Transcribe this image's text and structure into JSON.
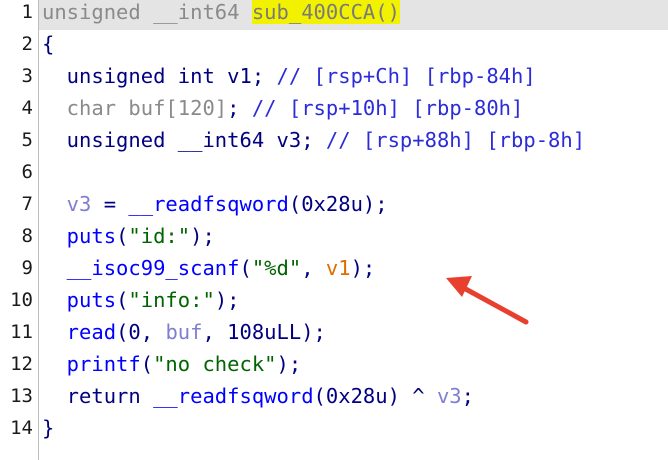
{
  "line_numbers": [
    "1",
    "2",
    "3",
    "4",
    "5",
    "6",
    "7",
    "8",
    "9",
    "10",
    "11",
    "12",
    "13",
    "14"
  ],
  "code": {
    "l1_type": "unsigned __int64 ",
    "l1_fname": "sub_400CCA",
    "l1_parens": "()",
    "l2": "{",
    "l3_type": "  unsigned int ",
    "l3_var": "v1",
    "l3_semi": "; ",
    "l3_comment": "// [rsp+Ch] [rbp-84h]",
    "l4_type": "  char ",
    "l4_var": "buf[120]",
    "l4_semi": "; ",
    "l4_comment": "// [rsp+10h] [rbp-80h]",
    "l5_type": "  unsigned __int64 ",
    "l5_var": "v3",
    "l5_semi": "; ",
    "l5_comment": "// [rsp+88h] [rbp-8h]",
    "l7_var": "  v3",
    "l7_eq": " = ",
    "l7_fn": "__readfsqword",
    "l7_args": "(0x28u);",
    "l8_fn": "  puts",
    "l8_open": "(",
    "l8_str": "\"id:\"",
    "l8_close": ");",
    "l9_fn": "  __isoc99_scanf",
    "l9_open": "(",
    "l9_str": "\"%d\"",
    "l9_comma": ", ",
    "l9_arg": "v1",
    "l9_close": ");",
    "l10_fn": "  puts",
    "l10_open": "(",
    "l10_str": "\"info:\"",
    "l10_close": ");",
    "l11_fn": "  read",
    "l11_a": "(0, ",
    "l11_buf": "buf",
    "l11_b": ", 108uLL);",
    "l12_fn": "  printf",
    "l12_open": "(",
    "l12_str": "\"no check\"",
    "l12_close": ");",
    "l13_kw": "  return ",
    "l13_fn": "__readfsqword",
    "l13_a": "(0x28u) ^ ",
    "l13_var": "v3",
    "l13_b": ";",
    "l14": "}"
  },
  "annotation": {
    "color": "#e8402e",
    "icon": "arrow-annotation"
  }
}
